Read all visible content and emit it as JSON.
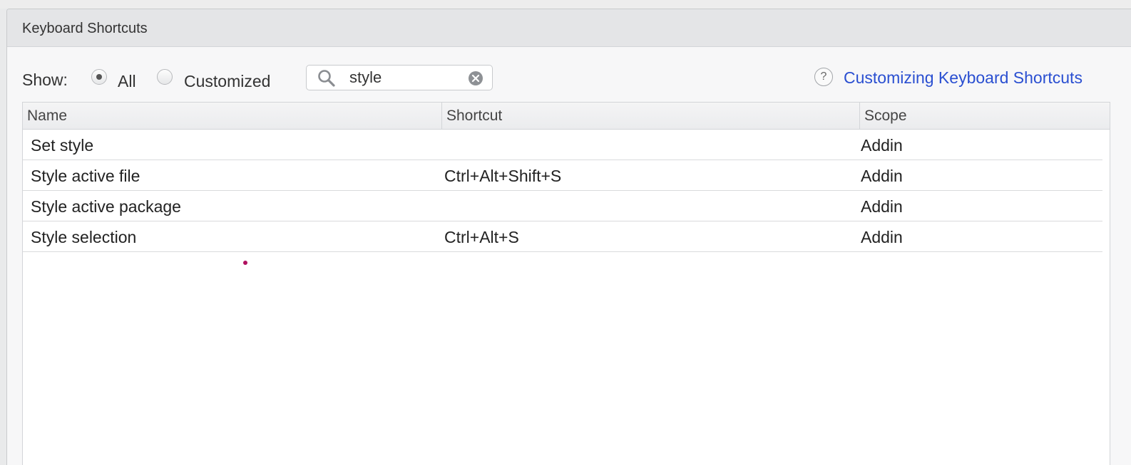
{
  "dialog": {
    "title": "Keyboard Shortcuts"
  },
  "toolbar": {
    "show_label": "Show:",
    "radio_all_label": "All",
    "radio_customized_label": "Customized",
    "selected_filter": "All",
    "search": {
      "value": "style",
      "icon": "search-icon",
      "clear_icon": "clear-icon"
    },
    "help_icon_glyph": "?",
    "help_link": "Customizing Keyboard Shortcuts"
  },
  "table": {
    "columns": [
      "Name",
      "Shortcut",
      "Scope"
    ],
    "rows": [
      {
        "name": "Set style",
        "shortcut": "",
        "scope": "Addin"
      },
      {
        "name": "Style active file",
        "shortcut": "Ctrl+Alt+Shift+S",
        "scope": "Addin"
      },
      {
        "name": "Style active package",
        "shortcut": "",
        "scope": "Addin"
      },
      {
        "name": "Style selection",
        "shortcut": "Ctrl+Alt+S",
        "scope": "Addin"
      }
    ]
  },
  "colors": {
    "link": "#2a4fd1",
    "marker": "#b0105f"
  }
}
